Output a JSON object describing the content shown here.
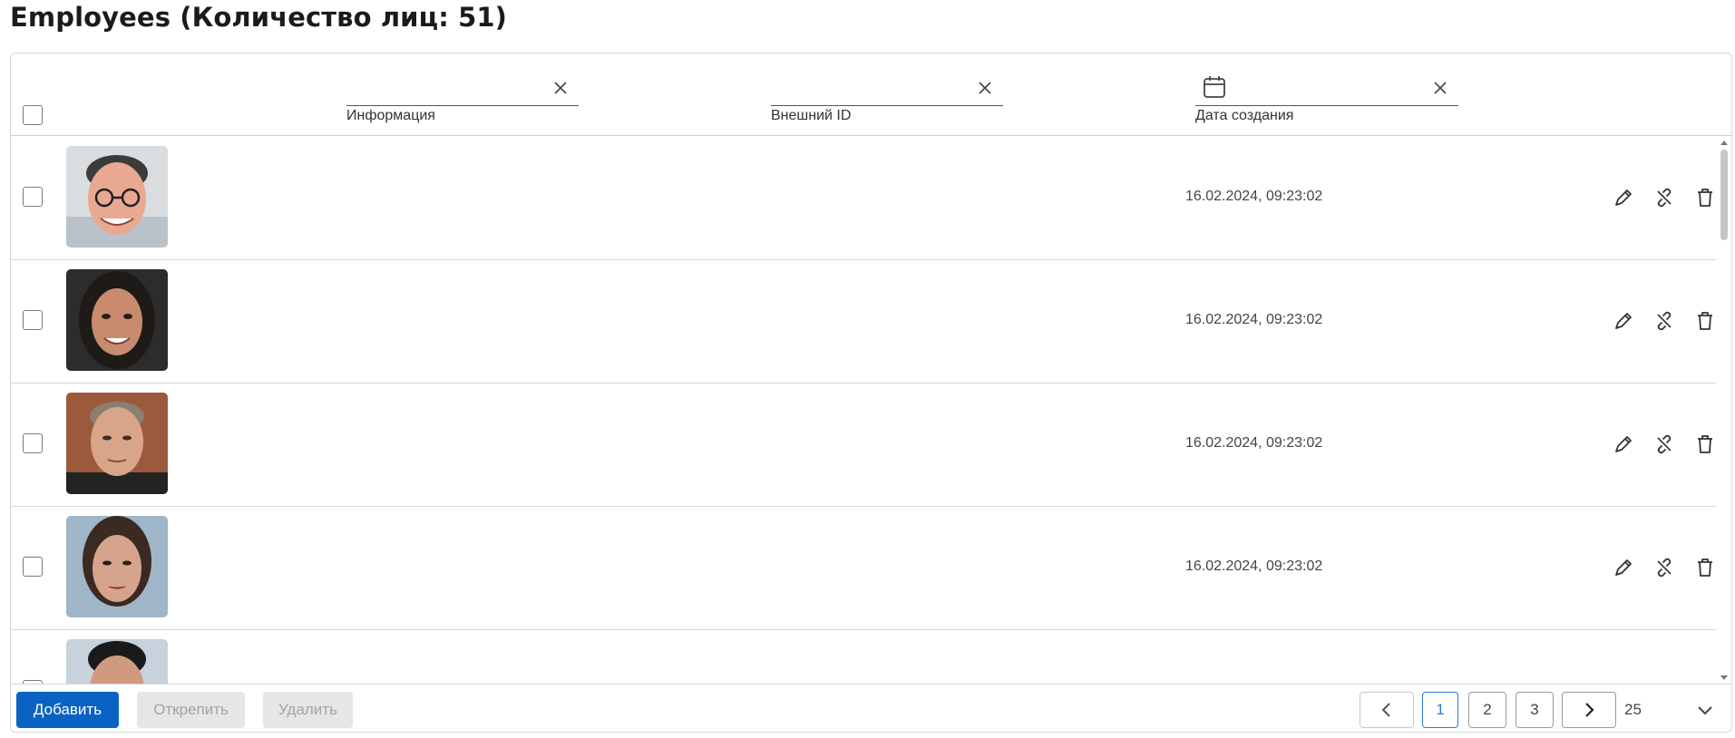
{
  "page": {
    "title": "Employees (Количество лиц: 51)"
  },
  "filters": {
    "info_label": "Информация",
    "external_id_label": "Внешний ID",
    "created_label": "Дата создания"
  },
  "rows": [
    {
      "date": "16.02.2024, 09:23:02"
    },
    {
      "date": "16.02.2024, 09:23:02"
    },
    {
      "date": "16.02.2024, 09:23:02"
    },
    {
      "date": "16.02.2024, 09:23:02"
    },
    {
      "date": ""
    }
  ],
  "footer": {
    "add_label": "Добавить",
    "unpin_label": "Открепить",
    "delete_label": "Удалить",
    "pages": [
      "1",
      "2",
      "3"
    ],
    "current_page": "1",
    "per_page": "25"
  },
  "icons": {
    "clear": "close-icon",
    "calendar": "calendar-icon",
    "edit": "pencil-icon",
    "unlink": "unlink-icon",
    "delete": "trash-icon",
    "prev": "chevron-left-icon",
    "next": "chevron-right-icon",
    "dropdown": "chevron-down-icon"
  },
  "colors": {
    "primary": "#0a63c2",
    "active_page": "#2a7ad6",
    "disabled_bg": "#e6e6e6"
  }
}
